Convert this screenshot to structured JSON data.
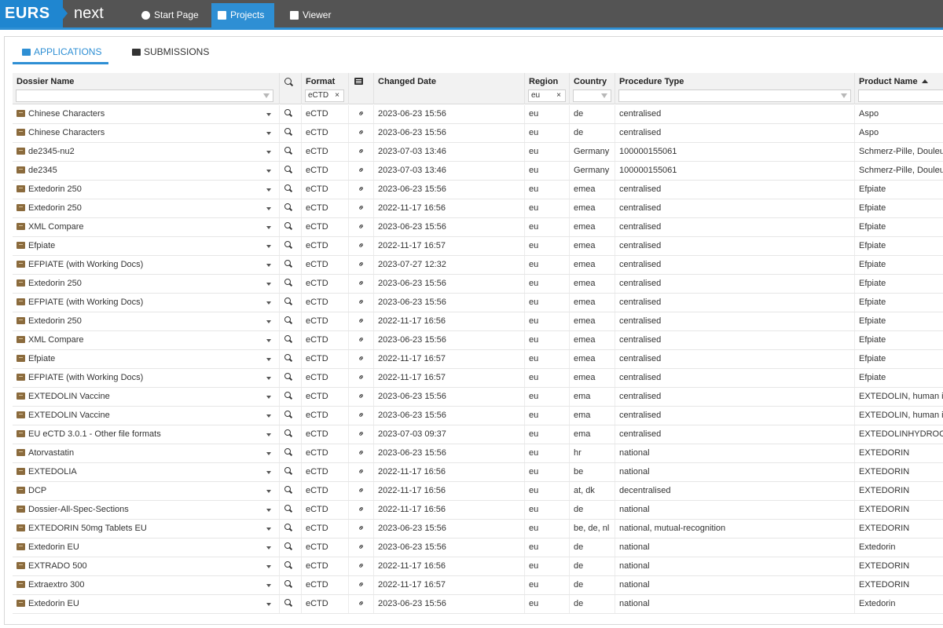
{
  "brand": {
    "left": "EURS",
    "right": "next"
  },
  "nav": [
    {
      "label": "Start Page",
      "icon": "pie-chart-icon"
    },
    {
      "label": "Projects",
      "icon": "archive-icon"
    },
    {
      "label": "Viewer",
      "icon": "book-icon"
    }
  ],
  "tabs": [
    {
      "label": "APPLICATIONS",
      "icon": "archive-icon"
    },
    {
      "label": "SUBMISSIONS",
      "icon": "list-icon"
    }
  ],
  "columns": {
    "dossier": "Dossier Name",
    "format": "Format",
    "changed": "Changed Date",
    "region": "Region",
    "country": "Country",
    "procedure": "Procedure Type",
    "product": "Product Name"
  },
  "filters": {
    "format": "eCTD",
    "region": "eu",
    "clear": "×"
  },
  "colors": {
    "accent": "#2e8fd4",
    "topbar": "#545454",
    "dossier_icon": "#8b6b3d"
  },
  "rows": [
    {
      "name": "Chinese Characters",
      "format": "eCTD",
      "changed": "2023-06-23 15:56",
      "region": "eu",
      "country": "de",
      "procedure": "centralised",
      "product": "Aspo"
    },
    {
      "name": "Chinese Characters",
      "format": "eCTD",
      "changed": "2023-06-23 15:56",
      "region": "eu",
      "country": "de",
      "procedure": "centralised",
      "product": "Aspo"
    },
    {
      "name": "de2345-nu2",
      "format": "eCTD",
      "changed": "2023-07-03 13:46",
      "region": "eu",
      "country": "Germany",
      "procedure": "100000155061",
      "product": "Schmerz-Pille, Douleur-Pilule"
    },
    {
      "name": "de2345",
      "format": "eCTD",
      "changed": "2023-07-03 13:46",
      "region": "eu",
      "country": "Germany",
      "procedure": "100000155061",
      "product": "Schmerz-Pille, Douleur-Pilule"
    },
    {
      "name": "Extedorin 250",
      "format": "eCTD",
      "changed": "2023-06-23 15:56",
      "region": "eu",
      "country": "emea",
      "procedure": "centralised",
      "product": "Efpiate"
    },
    {
      "name": "Extedorin 250",
      "format": "eCTD",
      "changed": "2022-11-17 16:56",
      "region": "eu",
      "country": "emea",
      "procedure": "centralised",
      "product": "Efpiate"
    },
    {
      "name": "XML Compare",
      "format": "eCTD",
      "changed": "2023-06-23 15:56",
      "region": "eu",
      "country": "emea",
      "procedure": "centralised",
      "product": "Efpiate"
    },
    {
      "name": "Efpiate",
      "format": "eCTD",
      "changed": "2022-11-17 16:57",
      "region": "eu",
      "country": "emea",
      "procedure": "centralised",
      "product": "Efpiate"
    },
    {
      "name": "EFPIATE (with Working Docs)",
      "format": "eCTD",
      "changed": "2023-07-27 12:32",
      "region": "eu",
      "country": "emea",
      "procedure": "centralised",
      "product": "Efpiate"
    },
    {
      "name": "Extedorin 250",
      "format": "eCTD",
      "changed": "2023-06-23 15:56",
      "region": "eu",
      "country": "emea",
      "procedure": "centralised",
      "product": "Efpiate"
    },
    {
      "name": "EFPIATE (with Working Docs)",
      "format": "eCTD",
      "changed": "2023-06-23 15:56",
      "region": "eu",
      "country": "emea",
      "procedure": "centralised",
      "product": "Efpiate"
    },
    {
      "name": "Extedorin 250",
      "format": "eCTD",
      "changed": "2022-11-17 16:56",
      "region": "eu",
      "country": "emea",
      "procedure": "centralised",
      "product": "Efpiate"
    },
    {
      "name": "XML Compare",
      "format": "eCTD",
      "changed": "2023-06-23 15:56",
      "region": "eu",
      "country": "emea",
      "procedure": "centralised",
      "product": "Efpiate"
    },
    {
      "name": "Efpiate",
      "format": "eCTD",
      "changed": "2022-11-17 16:57",
      "region": "eu",
      "country": "emea",
      "procedure": "centralised",
      "product": "Efpiate"
    },
    {
      "name": "EFPIATE (with Working Docs)",
      "format": "eCTD",
      "changed": "2022-11-17 16:57",
      "region": "eu",
      "country": "emea",
      "procedure": "centralised",
      "product": "Efpiate"
    },
    {
      "name": "EXTEDOLIN Vaccine",
      "format": "eCTD",
      "changed": "2023-06-23 15:56",
      "region": "eu",
      "country": "ema",
      "procedure": "centralised",
      "product": "EXTEDOLIN, human influenza"
    },
    {
      "name": "EXTEDOLIN Vaccine",
      "format": "eCTD",
      "changed": "2023-06-23 15:56",
      "region": "eu",
      "country": "ema",
      "procedure": "centralised",
      "product": "EXTEDOLIN, human influenza"
    },
    {
      "name": "EU eCTD 3.0.1 - Other file formats",
      "format": "eCTD",
      "changed": "2023-07-03 09:37",
      "region": "eu",
      "country": "ema",
      "procedure": "centralised",
      "product": "EXTEDOLINHYDROCHLORIDE"
    },
    {
      "name": "Atorvastatin",
      "format": "eCTD",
      "changed": "2023-06-23 15:56",
      "region": "eu",
      "country": "hr",
      "procedure": "national",
      "product": "EXTEDORIN"
    },
    {
      "name": "EXTEDOLIA",
      "format": "eCTD",
      "changed": "2022-11-17 16:56",
      "region": "eu",
      "country": "be",
      "procedure": "national",
      "product": "EXTEDORIN"
    },
    {
      "name": "DCP",
      "format": "eCTD",
      "changed": "2022-11-17 16:56",
      "region": "eu",
      "country": "at, dk",
      "procedure": "decentralised",
      "product": "EXTEDORIN"
    },
    {
      "name": "Dossier-All-Spec-Sections",
      "format": "eCTD",
      "changed": "2022-11-17 16:56",
      "region": "eu",
      "country": "de",
      "procedure": "national",
      "product": "EXTEDORIN"
    },
    {
      "name": "EXTEDORIN 50mg Tablets EU",
      "format": "eCTD",
      "changed": "2023-06-23 15:56",
      "region": "eu",
      "country": "be, de, nl",
      "procedure": "national, mutual-recognition",
      "product": "EXTEDORIN"
    },
    {
      "name": "Extedorin EU",
      "format": "eCTD",
      "changed": "2023-06-23 15:56",
      "region": "eu",
      "country": "de",
      "procedure": "national",
      "product": "Extedorin"
    },
    {
      "name": "EXTRADO 500",
      "format": "eCTD",
      "changed": "2022-11-17 16:56",
      "region": "eu",
      "country": "de",
      "procedure": "national",
      "product": "EXTEDORIN"
    },
    {
      "name": "Extraextro 300",
      "format": "eCTD",
      "changed": "2022-11-17 16:57",
      "region": "eu",
      "country": "de",
      "procedure": "national",
      "product": "EXTEDORIN"
    },
    {
      "name": "Extedorin EU",
      "format": "eCTD",
      "changed": "2023-06-23 15:56",
      "region": "eu",
      "country": "de",
      "procedure": "national",
      "product": "Extedorin"
    }
  ]
}
